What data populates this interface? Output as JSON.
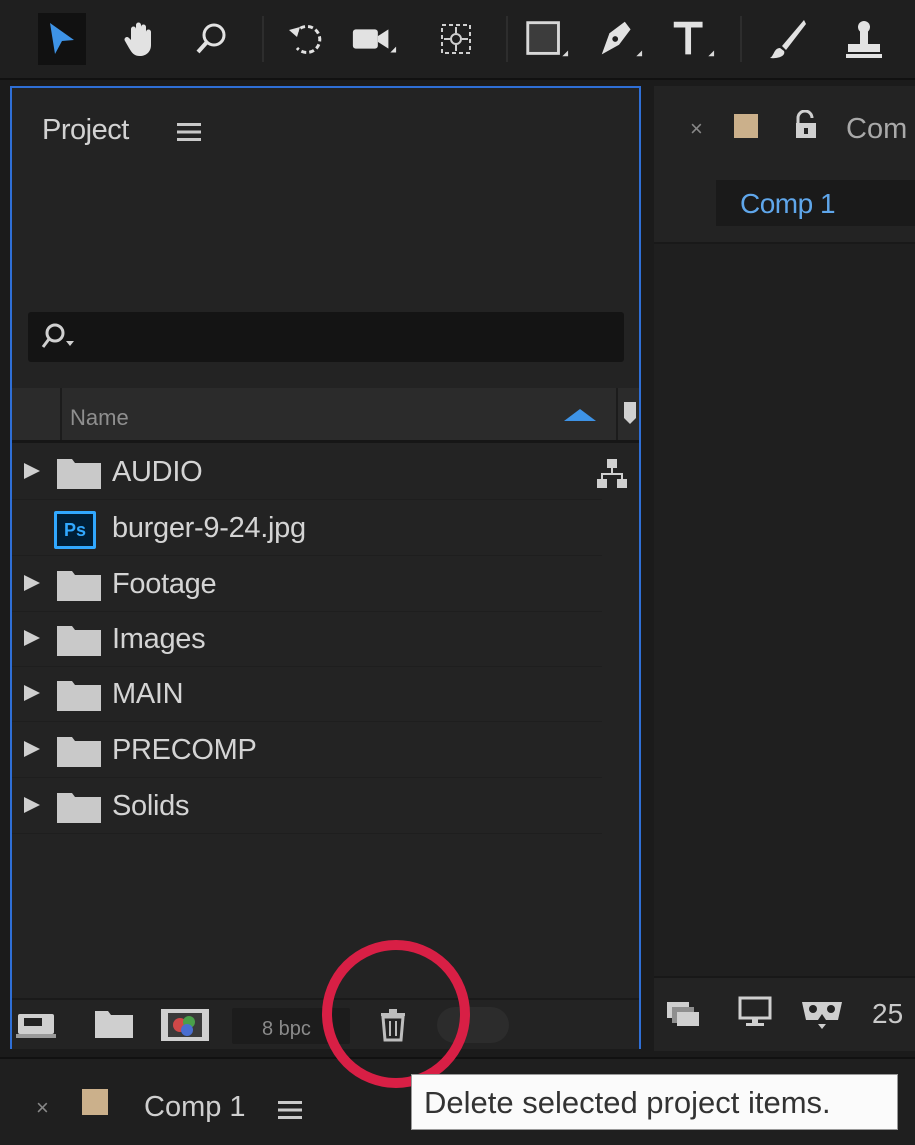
{
  "toolbar": {
    "tools": [
      "selection-tool",
      "hand-tool",
      "zoom-tool",
      "rotation-tool",
      "camera-tool",
      "pan-behind-tool",
      "rectangle-tool",
      "pen-tool",
      "type-tool",
      "brush-tool",
      "clone-stamp-tool"
    ],
    "active_tool": "selection-tool"
  },
  "project": {
    "title": "Project",
    "column_name": "Name",
    "items": [
      {
        "label": "AUDIO",
        "type": "folder"
      },
      {
        "label": "burger-9-24.jpg",
        "type": "photoshop-file"
      },
      {
        "label": "Footage",
        "type": "folder"
      },
      {
        "label": "Images",
        "type": "folder"
      },
      {
        "label": "MAIN",
        "type": "folder"
      },
      {
        "label": "PRECOMP",
        "type": "folder"
      },
      {
        "label": "Solids",
        "type": "folder"
      }
    ],
    "bit_depth": "8 bpc",
    "ps_badge": "Ps"
  },
  "composition": {
    "tab_name": "Com",
    "active_tab": "Comp 1",
    "zoom_partial": "25",
    "swatch_color": "#cbb08b"
  },
  "timeline": {
    "tab_name": "Comp 1",
    "close": "×"
  },
  "tooltip": {
    "text": "Delete selected project items."
  },
  "colors": {
    "accent_blue": "#2f6fd6",
    "highlight_red": "#d81f45",
    "ps_blue": "#31a8ff"
  }
}
